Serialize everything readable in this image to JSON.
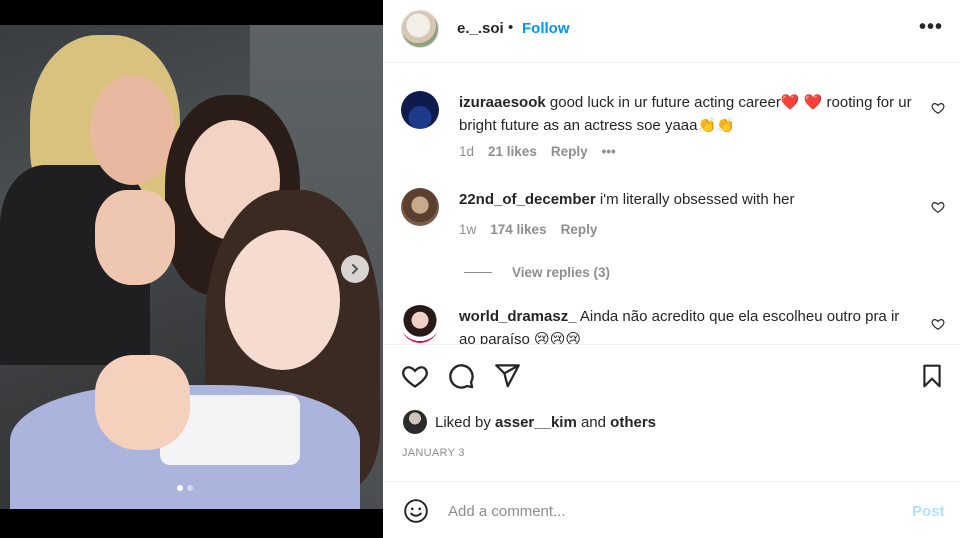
{
  "post": {
    "username": "e._.soi",
    "separator": "•",
    "follow_label": "Follow",
    "more_label": "•••",
    "carousel": {
      "current": 1,
      "total": 2
    }
  },
  "comments": [
    {
      "username": "izuraaesook",
      "text": "good luck in ur future acting career❤️ ❤️ rooting for ur bright future as an actress soe yaaa👏👏",
      "age": "1d",
      "likes": "21 likes",
      "reply_label": "Reply",
      "more_label": "•••"
    },
    {
      "username": "22nd_of_december",
      "text": "i'm literally obsessed with her",
      "age": "1w",
      "likes": "174 likes",
      "reply_label": "Reply",
      "view_replies": "View replies (3)"
    },
    {
      "username": "world_dramasz_",
      "text": "Ainda não acredito que ela escolheu outro pra ir ao paraíso 😢😢😢"
    }
  ],
  "likes_bar": {
    "prefix": "Liked by",
    "user": "asser__kim",
    "and": "and",
    "others": "others"
  },
  "date": "JANUARY 3",
  "composer": {
    "placeholder": "Add a comment...",
    "post_label": "Post"
  },
  "colors": {
    "link": "#0095f6",
    "muted": "#8e8e8e",
    "post_disabled": "#b2dffc"
  }
}
